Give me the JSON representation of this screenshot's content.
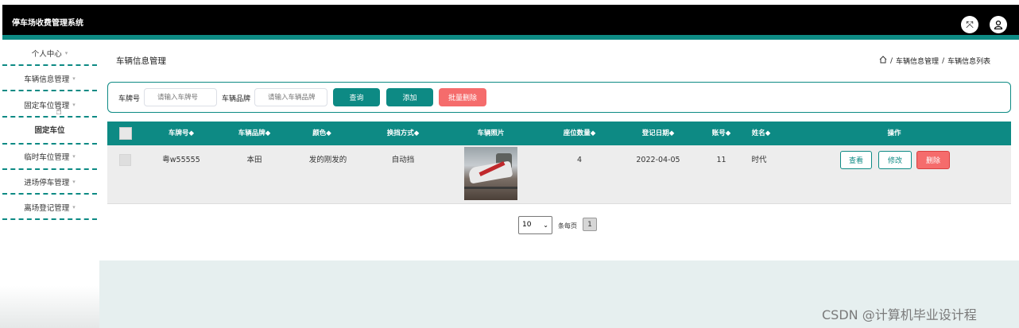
{
  "app": {
    "title": "停车场收费管理系统"
  },
  "header": {
    "icons": [
      "expand-icon",
      "user-icon"
    ]
  },
  "sidebar": {
    "items": [
      {
        "label": "个人中心",
        "caret": "▾"
      },
      {
        "label": "车辆信息管理",
        "caret": "▾"
      },
      {
        "label": "固定车位管理",
        "caret": "▾"
      },
      {
        "label": "固定车位",
        "caret": ""
      },
      {
        "label": "临时车位管理",
        "caret": "▾"
      },
      {
        "label": "进场停车管理",
        "caret": "▾"
      },
      {
        "label": "离场登记管理",
        "caret": "▾"
      }
    ]
  },
  "page": {
    "title": "车辆信息管理",
    "breadcrumb": {
      "home_icon": "home-icon",
      "sep1": "/",
      "level1": "车辆信息管理",
      "sep2": "/",
      "level2": "车辆信息列表"
    }
  },
  "search": {
    "plate_label": "车牌号",
    "plate_placeholder": "请输入车牌号",
    "brand_label": "车辆品牌",
    "brand_placeholder": "请输入车辆品牌",
    "query_button": "查询",
    "add_button": "添加",
    "batch_delete_button": "批量删除"
  },
  "table": {
    "headers": [
      "车牌号◆",
      "车辆品牌◆",
      "颜色◆",
      "换挡方式◆",
      "车辆照片",
      "座位数量◆",
      "登记日期◆",
      "账号◆",
      "姓名◆",
      "操作"
    ],
    "rows": [
      {
        "plate": "粤w55555",
        "brand": "本田",
        "color": "发的刚发的",
        "gear": "自动挡",
        "seats": "4",
        "date": "2022-04-05",
        "account": "11",
        "name": "时代",
        "actions": {
          "view": "查看",
          "edit": "修改",
          "delete": "删除"
        }
      }
    ]
  },
  "pagination": {
    "page_size": "10",
    "arrow": "⌄",
    "per_page_label": "条每页",
    "current_page": "1"
  },
  "watermark": "CSDN @计算机毕业设计程",
  "colors": {
    "accent": "#0d8a84",
    "danger": "#f56c6c",
    "header_bg": "#000000"
  }
}
